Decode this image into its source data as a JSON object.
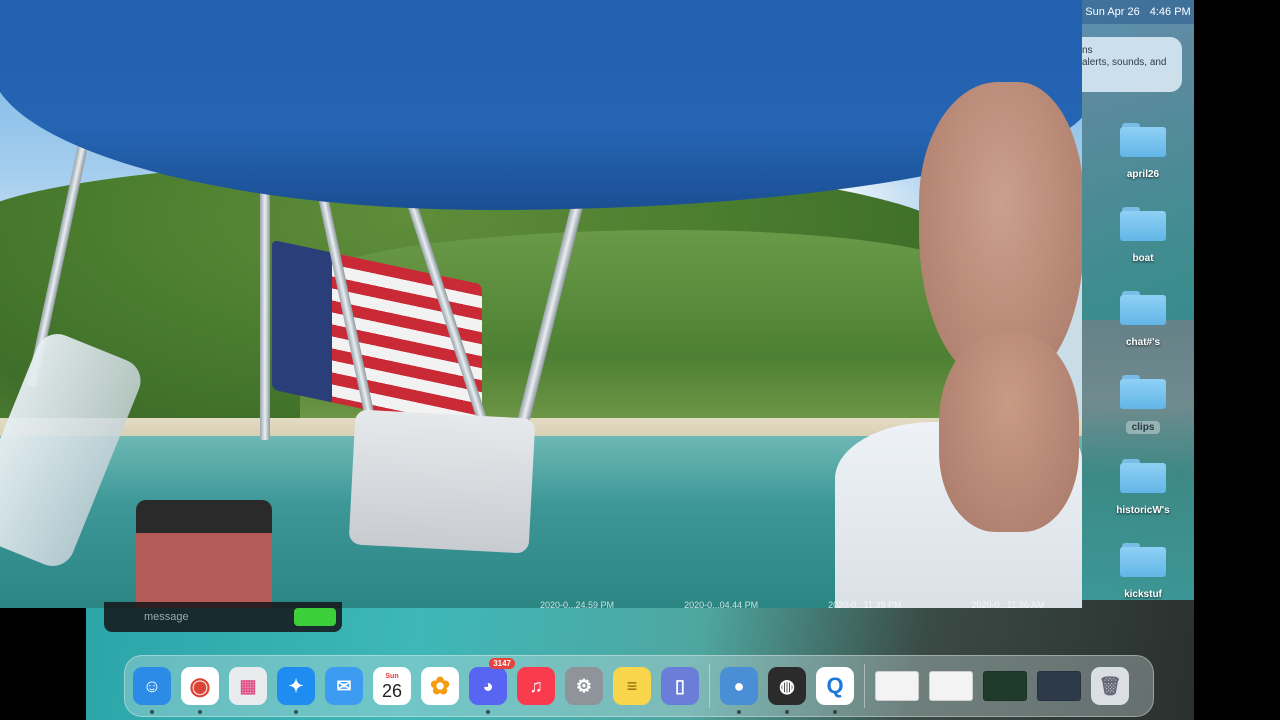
{
  "menubar": {
    "date": "Sun Apr 26",
    "time": "4:46 PM"
  },
  "notification": {
    "line1": "ns",
    "line2": "alerts, sounds, and"
  },
  "folders": [
    {
      "label": "april26"
    },
    {
      "label": "boat"
    },
    {
      "label": "chat#'s"
    },
    {
      "label": "clips"
    },
    {
      "label": "historicW's"
    },
    {
      "label": "kickstuf"
    }
  ],
  "overlay": {
    "message_placeholder": "message",
    "timestamps": [
      "2020-0...24.59 PM",
      "2020-0...04.44 PM",
      "2020-0...11.39 PM",
      "2020-0...11.36 AM"
    ]
  },
  "dock": {
    "apps": [
      {
        "name": "Finder",
        "icon": "finder-icon",
        "color": "#2b8be6",
        "glyph": "☺"
      },
      {
        "name": "Google Chrome",
        "icon": "chrome-icon",
        "color": "#ffffff",
        "glyph": "◉"
      },
      {
        "name": "Launchpad",
        "icon": "launchpad-icon",
        "color": "#e9ecef",
        "glyph": "▦"
      },
      {
        "name": "Safari",
        "icon": "safari-icon",
        "color": "#1e8cf0",
        "glyph": "✦"
      },
      {
        "name": "Mail",
        "icon": "mail-icon",
        "color": "#3d9bf2",
        "glyph": "✉"
      },
      {
        "name": "Calendar",
        "icon": "calendar-icon",
        "color": "#ffffff",
        "month": "Sun",
        "day": "26"
      },
      {
        "name": "Photos",
        "icon": "photos-icon",
        "color": "#ffffff",
        "glyph": "✿"
      },
      {
        "name": "Discord",
        "icon": "discord-icon",
        "color": "#5865f2",
        "glyph": "◕",
        "badge": "3147"
      },
      {
        "name": "Music",
        "icon": "music-icon",
        "color": "#fa3b4d",
        "glyph": "♫"
      },
      {
        "name": "System Preferences",
        "icon": "gear-icon",
        "color": "#8e9499",
        "glyph": "⚙"
      },
      {
        "name": "Notes",
        "icon": "notes-icon",
        "color": "#f8d54a",
        "glyph": "≡"
      },
      {
        "name": "Simulator",
        "icon": "simulator-icon",
        "color": "#6a7dd8",
        "glyph": "▯"
      },
      {
        "name": "Elgato Camera Hub",
        "icon": "camera-hub-icon",
        "color": "#4a8fd6",
        "glyph": "●"
      },
      {
        "name": "OBS",
        "icon": "obs-icon",
        "color": "#2b2b2b",
        "glyph": "◍"
      },
      {
        "name": "QuickTime",
        "icon": "quicktime-icon",
        "color": "#ffffff",
        "glyph": "Q"
      }
    ],
    "trash": {
      "name": "Trash",
      "icon": "trash-icon"
    }
  }
}
